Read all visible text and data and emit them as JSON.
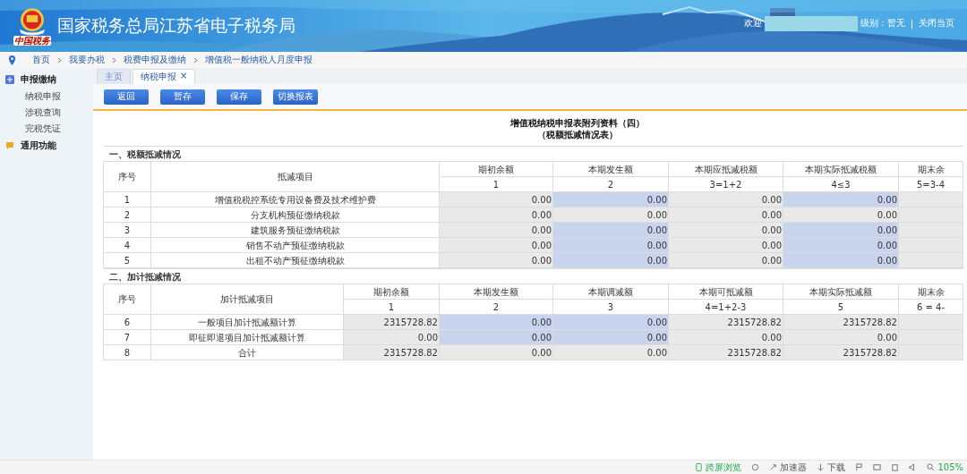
{
  "header": {
    "title": "国家税务总局江苏省电子税务局",
    "logo_caption": "中国税务",
    "welcome": "欢迎",
    "level": "级别：暂无",
    "separator": "|",
    "close": "关闭当页"
  },
  "breadcrumb": [
    "首页",
    "我要办税",
    "税费申报及缴纳",
    "增值税一般纳税人月度申报"
  ],
  "sidebar": [
    {
      "label": "申报缴纳",
      "children": [
        {
          "label": "纳税申报"
        },
        {
          "label": "涉税查询"
        },
        {
          "label": "完税凭证"
        }
      ]
    },
    {
      "label": "通用功能"
    }
  ],
  "tabs": [
    {
      "label": "主页",
      "selected": false
    },
    {
      "label": "纳税申报",
      "selected": true,
      "close": "×"
    }
  ],
  "toolbar": [
    "返回",
    "暂存",
    "保存",
    "切换报表"
  ],
  "form": {
    "title": "增值税纳税申报表附列资料（四）",
    "subtitle": "（税额抵减情况表）",
    "sections": [
      {
        "heading": "一、税额抵减情况",
        "no_header": "序号",
        "item_header": "抵减项目",
        "columns": [
          {
            "label": "期初余额",
            "formula": "1"
          },
          {
            "label": "本期发生额",
            "formula": "2"
          },
          {
            "label": "本期应抵减税额",
            "formula": "3=1+2"
          },
          {
            "label": "本期实际抵减税额",
            "formula": "4≤3"
          },
          {
            "label": "期末余",
            "formula": "5=3-4"
          }
        ],
        "rows": [
          {
            "no": "1",
            "item": "增值税税控系统专用设备费及技术维护费",
            "cells": [
              {
                "value": "0.00",
                "editable": false
              },
              {
                "value": "0.00",
                "editable": true
              },
              {
                "value": "0.00",
                "editable": false
              },
              {
                "value": "0.00",
                "editable": true
              }
            ]
          },
          {
            "no": "2",
            "item": "分支机构预征缴纳税款",
            "cells": [
              {
                "value": "0.00",
                "editable": false
              },
              {
                "value": "0.00",
                "editable": false
              },
              {
                "value": "0.00",
                "editable": false
              },
              {
                "value": "0.00",
                "editable": false
              }
            ]
          },
          {
            "no": "3",
            "item": "建筑服务预征缴纳税款",
            "cells": [
              {
                "value": "0.00",
                "editable": false
              },
              {
                "value": "0.00",
                "editable": true
              },
              {
                "value": "0.00",
                "editable": false
              },
              {
                "value": "0.00",
                "editable": true
              }
            ]
          },
          {
            "no": "4",
            "item": "销售不动产预征缴纳税款",
            "cells": [
              {
                "value": "0.00",
                "editable": false
              },
              {
                "value": "0.00",
                "editable": true
              },
              {
                "value": "0.00",
                "editable": false
              },
              {
                "value": "0.00",
                "editable": true
              }
            ]
          },
          {
            "no": "5",
            "item": "出租不动产预征缴纳税款",
            "cells": [
              {
                "value": "0.00",
                "editable": false
              },
              {
                "value": "0.00",
                "editable": true
              },
              {
                "value": "0.00",
                "editable": false
              },
              {
                "value": "0.00",
                "editable": true
              }
            ]
          }
        ]
      },
      {
        "heading": "二、加计抵减情况",
        "no_header": "序号",
        "item_header": "加计抵减项目",
        "columns": [
          {
            "label": "期初余额",
            "formula": "1"
          },
          {
            "label": "本期发生额",
            "formula": "2"
          },
          {
            "label": "本期调减额",
            "formula": "3"
          },
          {
            "label": "本期可抵减额",
            "formula": "4=1+2-3"
          },
          {
            "label": "本期实际抵减额",
            "formula": "5"
          },
          {
            "label": "期末余",
            "formula": "6 = 4-"
          }
        ],
        "rows": [
          {
            "no": "6",
            "item": "一般项目加计抵减额计算",
            "cells": [
              {
                "value": "2315728.82",
                "editable": false
              },
              {
                "value": "0.00",
                "editable": true
              },
              {
                "value": "0.00",
                "editable": true
              },
              {
                "value": "2315728.82",
                "editable": false
              },
              {
                "value": "2315728.82",
                "editable": false
              }
            ]
          },
          {
            "no": "7",
            "item": "即征即退项目加计抵减额计算",
            "cells": [
              {
                "value": "0.00",
                "editable": false
              },
              {
                "value": "0.00",
                "editable": true
              },
              {
                "value": "0.00",
                "editable": true
              },
              {
                "value": "0.00",
                "editable": false
              },
              {
                "value": "0.00",
                "editable": false
              }
            ]
          },
          {
            "no": "8",
            "item": "合计",
            "cells": [
              {
                "value": "2315728.82",
                "editable": false
              },
              {
                "value": "0.00",
                "editable": false
              },
              {
                "value": "0.00",
                "editable": false
              },
              {
                "value": "2315728.82",
                "editable": false
              },
              {
                "value": "2315728.82",
                "editable": false
              }
            ]
          }
        ]
      }
    ]
  },
  "status_bar": {
    "cast": "跨屏浏览",
    "accelerator": "加速器",
    "download": "下载",
    "zoom": "105%"
  }
}
